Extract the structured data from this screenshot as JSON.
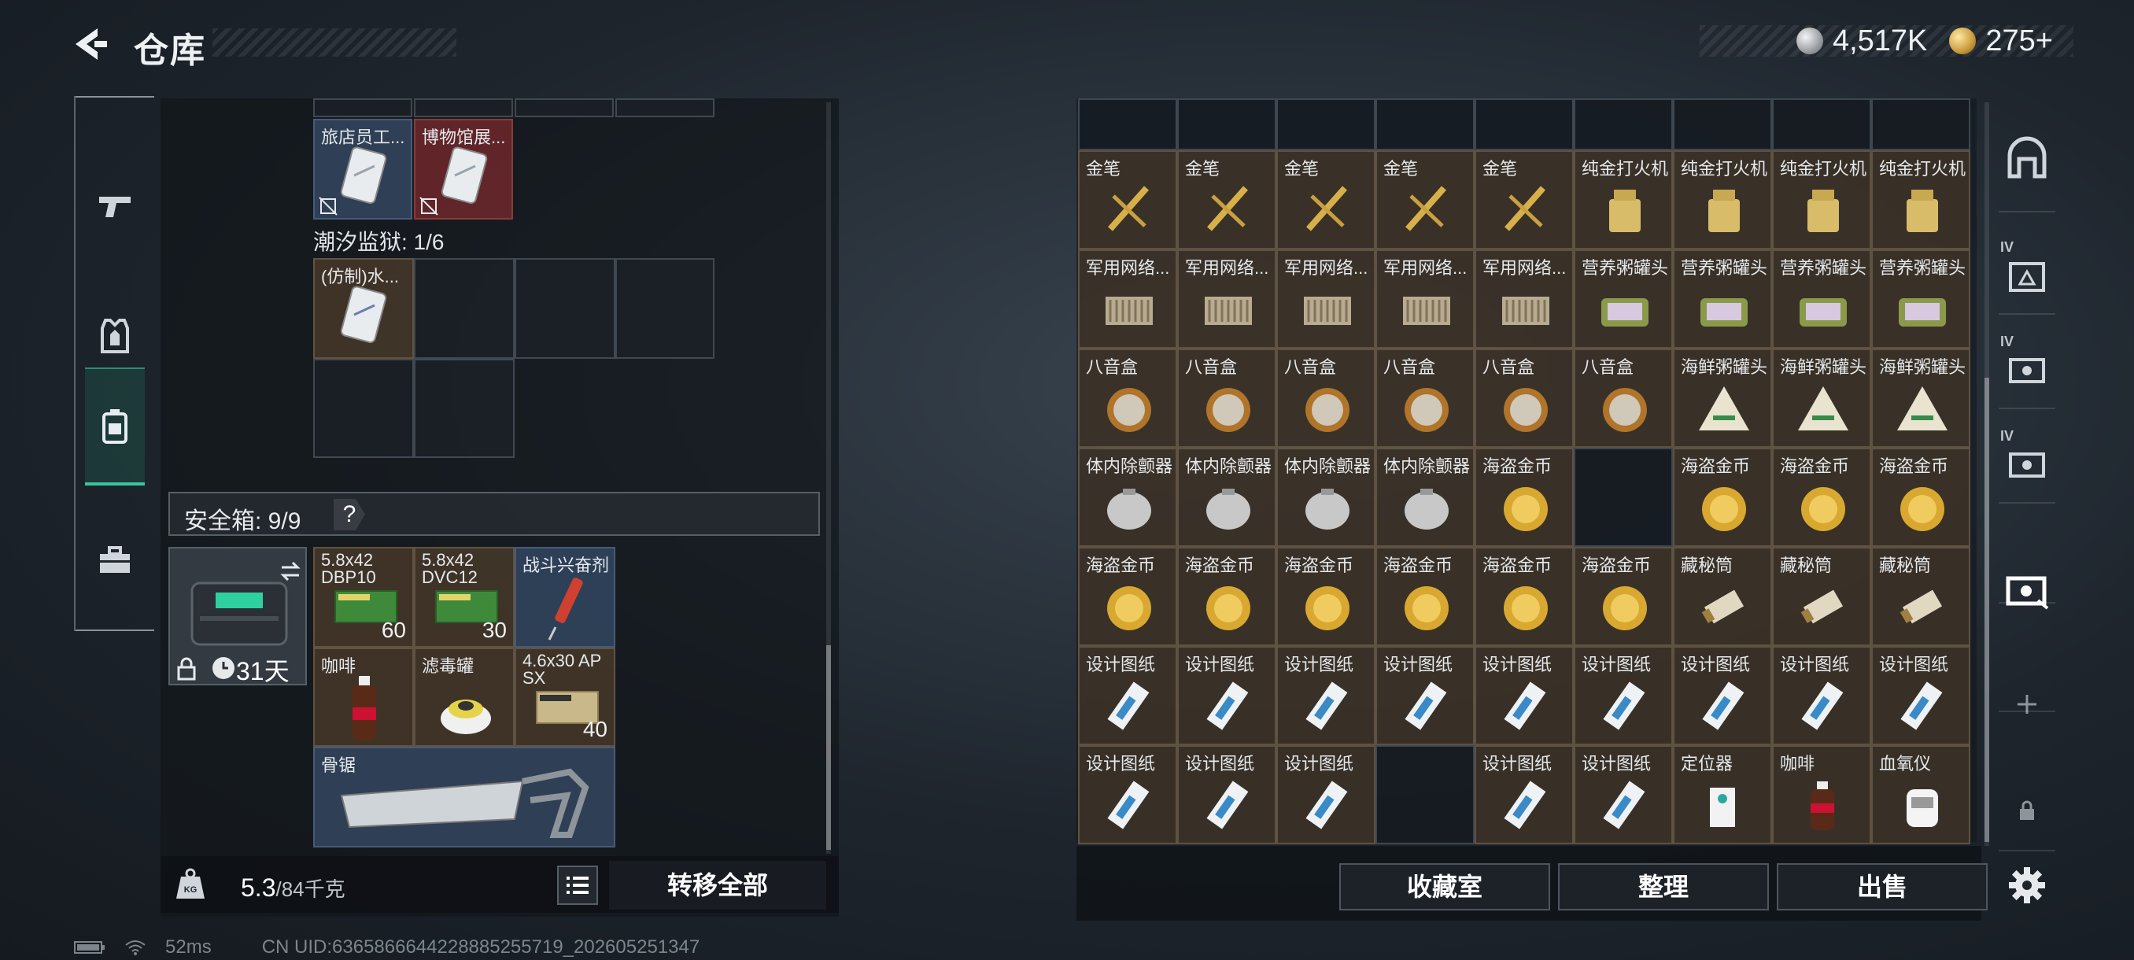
{
  "header": {
    "title": "仓库",
    "currency": [
      {
        "icon": "silver-coin-icon",
        "value": "4,517K"
      },
      {
        "icon": "gold-coin-icon",
        "value": "275+"
      }
    ]
  },
  "left_nav": [
    {
      "icon": "gun-icon"
    },
    {
      "icon": "armor-vest-icon"
    },
    {
      "icon": "backpack-icon",
      "active": true
    },
    {
      "icon": "briefcase-icon"
    }
  ],
  "left": {
    "top_items": [
      "旅店员工...",
      "博物馆展..."
    ],
    "prison_label": "潮汐监狱: 1/6",
    "prison_item": "(仿制)水...",
    "safebox_label": "安全箱: 9/9",
    "safebox_help": "?",
    "safebox_days": "31天",
    "safe_items": [
      {
        "label": "5.8x42 DBP10",
        "count": "60"
      },
      {
        "label": "5.8x42 DVC12",
        "count": "30"
      },
      {
        "label": "战斗兴奋剂",
        "count": ""
      },
      {
        "label": "咖啡",
        "count": ""
      },
      {
        "label": "滤毒罐",
        "count": ""
      },
      {
        "label": "4.6x30 AP SX",
        "count": "40"
      },
      {
        "label": "骨锯",
        "count": ""
      }
    ],
    "weight_current": "5.3",
    "weight_max": "/84千克",
    "transfer_label": "转移全部"
  },
  "right": {
    "grid": [
      [
        "",
        "",
        "",
        "",
        "",
        "",
        "",
        "",
        ""
      ],
      [
        "金笔",
        "金笔",
        "金笔",
        "金笔",
        "金笔",
        "纯金打火机",
        "纯金打火机",
        "纯金打火机",
        "纯金打火机"
      ],
      [
        "军用网络...",
        "军用网络...",
        "军用网络...",
        "军用网络...",
        "军用网络...",
        "营养粥罐头",
        "营养粥罐头",
        "营养粥罐头",
        "营养粥罐头"
      ],
      [
        "八音盒",
        "八音盒",
        "八音盒",
        "八音盒",
        "八音盒",
        "八音盒",
        "海鲜粥罐头",
        "海鲜粥罐头",
        "海鲜粥罐头"
      ],
      [
        "体内除颤器",
        "体内除颤器",
        "体内除颤器",
        "体内除颤器",
        "海盗金币",
        "",
        "海盗金币",
        "海盗金币",
        "海盗金币"
      ],
      [
        "海盗金币",
        "海盗金币",
        "海盗金币",
        "海盗金币",
        "海盗金币",
        "海盗金币",
        "藏秘筒",
        "藏秘筒",
        "藏秘筒"
      ],
      [
        "设计图纸",
        "设计图纸",
        "设计图纸",
        "设计图纸",
        "设计图纸",
        "设计图纸",
        "设计图纸",
        "设计图纸",
        "设计图纸"
      ],
      [
        "设计图纸",
        "设计图纸",
        "设计图纸",
        "",
        "设计图纸",
        "设计图纸",
        "定位器",
        "咖啡",
        "血氧仪"
      ]
    ],
    "buttons": {
      "collection": "收藏室",
      "sort": "整理",
      "sell": "出售"
    }
  },
  "right_nav": [
    {
      "icon": "arch-icon"
    },
    {
      "icon": "tier-iv-case-icon",
      "tier": "IV"
    },
    {
      "icon": "tier-iv-case-icon",
      "tier": "IV"
    },
    {
      "icon": "tier-iv-case-icon",
      "tier": "IV"
    },
    {
      "icon": "case-icon",
      "active": true
    },
    {
      "icon": "plus-icon"
    },
    {
      "icon": "lock-icon"
    },
    {
      "icon": "gear-icon"
    }
  ],
  "status": {
    "ping": "52ms",
    "uid": "CN UID:6365866644228885255719_202605251347"
  }
}
